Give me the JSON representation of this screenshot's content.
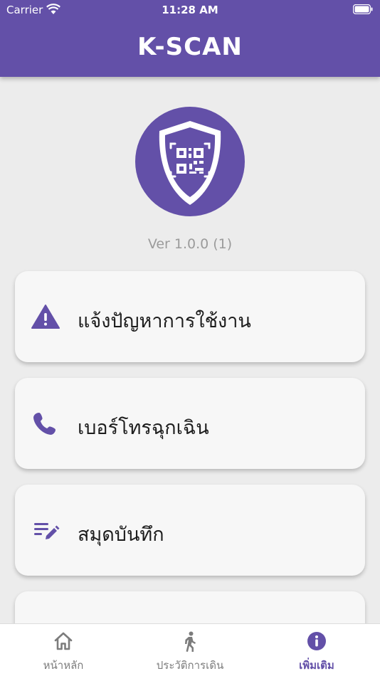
{
  "status_bar": {
    "carrier": "Carrier",
    "time": "11:28 AM"
  },
  "header": {
    "title": "K-SCAN"
  },
  "app": {
    "version": "Ver 1.0.0 (1)"
  },
  "menu": [
    {
      "label": "แจ้งปัญหาการใช้งาน",
      "icon": "warning-icon"
    },
    {
      "label": "เบอร์โทรฉุกเฉิน",
      "icon": "phone-icon"
    },
    {
      "label": "สมุดบันทึก",
      "icon": "notes-icon"
    },
    {
      "label": "",
      "icon": "info-icon"
    }
  ],
  "bottom_nav": [
    {
      "label": "หน้าหลัก",
      "icon": "home-icon"
    },
    {
      "label": "ประวัติการเดิน",
      "icon": "walking-icon"
    },
    {
      "label": "เพิ่มเติม",
      "icon": "info-icon",
      "active": true
    }
  ],
  "colors": {
    "primary": "#6350a8",
    "background": "#ececec",
    "card": "#f7f7f7",
    "muted": "#9b9b9b"
  }
}
